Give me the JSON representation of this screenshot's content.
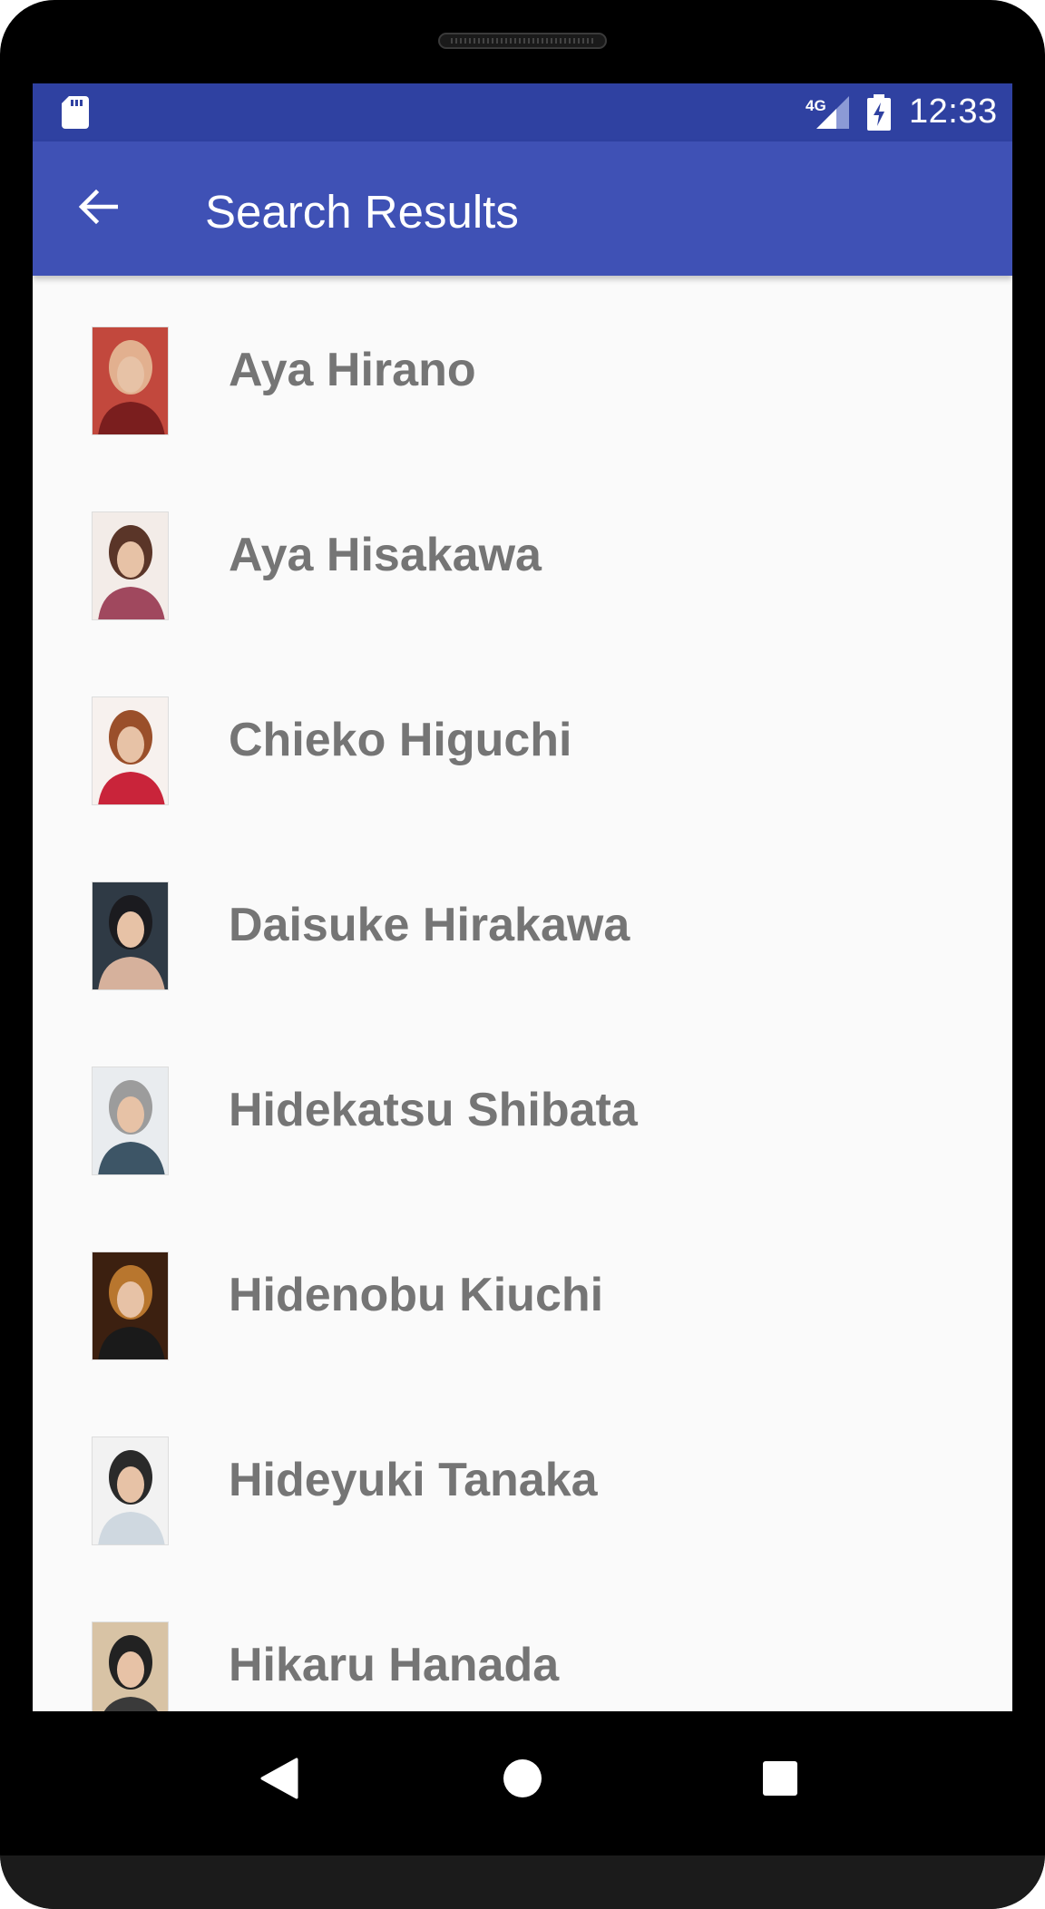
{
  "status_bar": {
    "network_label": "4G",
    "time": "12:33",
    "icons": [
      "sd-card-icon",
      "signal-icon",
      "battery-charging-icon"
    ]
  },
  "app_bar": {
    "title": "Search Results",
    "back_icon": "arrow-back-icon"
  },
  "results": [
    {
      "name": "Aya Hirano",
      "photo_tones": [
        "#c2483d",
        "#e2b08f",
        "#7a1e1e"
      ]
    },
    {
      "name": "Aya Hisakawa",
      "photo_tones": [
        "#f3ece8",
        "#5a3528",
        "#a0485e"
      ]
    },
    {
      "name": "Chieko Higuchi",
      "photo_tones": [
        "#f7f1ee",
        "#9a4f2a",
        "#c9243a"
      ]
    },
    {
      "name": "Daisuke Hirakawa",
      "photo_tones": [
        "#2f3a45",
        "#1b1b1f",
        "#d6b19c"
      ]
    },
    {
      "name": "Hidekatsu Shibata",
      "photo_tones": [
        "#e9ecef",
        "#9c9c9c",
        "#3d5566"
      ]
    },
    {
      "name": "Hidenobu Kiuchi",
      "photo_tones": [
        "#3c2010",
        "#b8762e",
        "#1a1a1a"
      ]
    },
    {
      "name": "Hideyuki Tanaka",
      "photo_tones": [
        "#f2f2f2",
        "#2a2a2a",
        "#cfd8e0"
      ]
    },
    {
      "name": "Hikaru Hanada",
      "photo_tones": [
        "#d8c3a5",
        "#222222",
        "#3a3a3a"
      ]
    }
  ],
  "navigation": {
    "back": "nav-back-icon",
    "home": "nav-home-icon",
    "recents": "nav-recents-icon"
  },
  "colors": {
    "status_bar": "#2f41a1",
    "app_bar": "#3f51b5",
    "background": "#fafafa",
    "item_text": "#757575"
  }
}
